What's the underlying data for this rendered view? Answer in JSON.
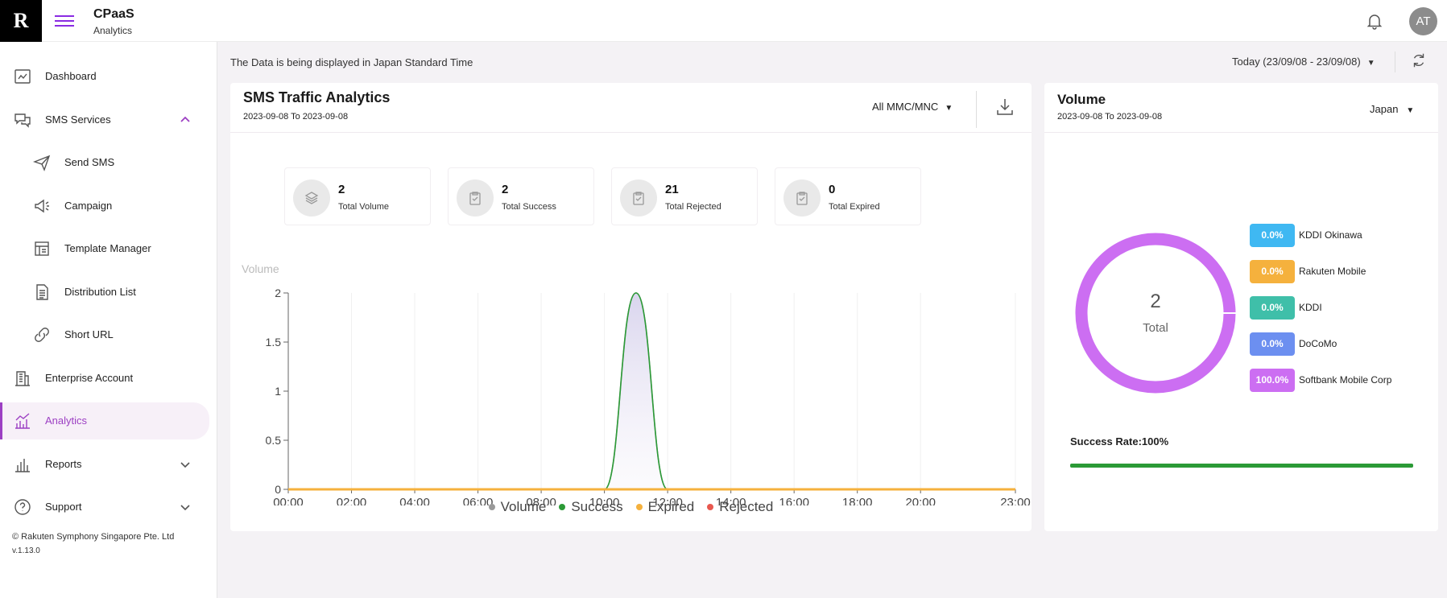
{
  "header": {
    "logo": "R",
    "app_title": "CPaaS",
    "app_subtitle": "Analytics",
    "avatar_initials": "AT"
  },
  "sidebar": {
    "items": [
      {
        "label": "Dashboard",
        "icon": "dashboard-icon"
      },
      {
        "label": "SMS Services",
        "icon": "chat-bubbles-icon",
        "expanded": true
      },
      {
        "label": "Send SMS",
        "icon": "paper-plane-icon"
      },
      {
        "label": "Campaign",
        "icon": "megaphone-icon"
      },
      {
        "label": "Template Manager",
        "icon": "template-icon"
      },
      {
        "label": "Distribution List",
        "icon": "document-list-icon"
      },
      {
        "label": "Short URL",
        "icon": "link-icon"
      },
      {
        "label": "Enterprise Account",
        "icon": "building-icon"
      },
      {
        "label": "Analytics",
        "icon": "analytics-icon",
        "active": true
      },
      {
        "label": "Reports",
        "icon": "bar-chart-icon",
        "expanded": false
      },
      {
        "label": "Support",
        "icon": "help-icon",
        "expanded": false
      }
    ],
    "copyright": "© Rakuten Symphony Singapore Pte. Ltd",
    "version": "v.1.13.0"
  },
  "toolbar": {
    "timezone_note": "The Data is being displayed in Japan Standard Time",
    "date_range": "Today (23/09/08 - 23/09/08)"
  },
  "traffic": {
    "title": "SMS Traffic Analytics",
    "range": "2023-09-08 To 2023-09-08",
    "filter": "All MMC/MNC",
    "stats": [
      {
        "value": "2",
        "label": "Total Volume",
        "icon": "layers-icon"
      },
      {
        "value": "2",
        "label": "Total Success",
        "icon": "clipboard-check-icon"
      },
      {
        "value": "21",
        "label": "Total Rejected",
        "icon": "clipboard-check-icon"
      },
      {
        "value": "0",
        "label": "Total Expired",
        "icon": "clipboard-check-icon"
      }
    ]
  },
  "volume": {
    "title": "Volume",
    "range": "2023-09-08 To 2023-09-08",
    "country": "Japan",
    "donut_total": "2",
    "donut_total_label": "Total",
    "operators": [
      {
        "pct": "0.0%",
        "name": "KDDI Okinawa",
        "color": "#3fb8f2"
      },
      {
        "pct": "0.0%",
        "name": "Rakuten Mobile",
        "color": "#f5b13d"
      },
      {
        "pct": "0.0%",
        "name": "KDDI",
        "color": "#3fbfa9"
      },
      {
        "pct": "0.0%",
        "name": "DoCoMo",
        "color": "#6c8ff0"
      },
      {
        "pct": "100.0%",
        "name": "Softbank Mobile Corp",
        "color": "#cc6ef2"
      }
    ],
    "success_rate_label": "Success Rate",
    "success_rate_value": "100%",
    "success_rate": 1.0
  },
  "chart_data": {
    "type": "line",
    "ylabel": "Volume",
    "x": [
      "00:00",
      "02:00",
      "04:00",
      "06:00",
      "08:00",
      "10:00",
      "11:00",
      "12:00",
      "14:00",
      "16:00",
      "18:00",
      "20:00",
      "23:00"
    ],
    "x_ticks": [
      "00:00",
      "02:00",
      "04:00",
      "06:00",
      "08:00",
      "10:00",
      "12:00",
      "14:00",
      "16:00",
      "18:00",
      "20:00",
      "23:00"
    ],
    "y_ticks": [
      "0",
      "0.5",
      "1",
      "1.5",
      "2"
    ],
    "ylim": [
      0,
      2
    ],
    "xlim": [
      0,
      23
    ],
    "legend_position": "bottom",
    "series": [
      {
        "name": "Volume",
        "color": "#9a9a9a",
        "values": [
          0,
          0,
          0,
          0,
          0,
          0,
          2,
          0,
          0,
          0,
          0,
          0,
          0
        ]
      },
      {
        "name": "Success",
        "color": "#2b9a36",
        "values": [
          0,
          0,
          0,
          0,
          0,
          0,
          2,
          0,
          0,
          0,
          0,
          0,
          0
        ]
      },
      {
        "name": "Expired",
        "color": "#f5b13d",
        "values": [
          0,
          0,
          0,
          0,
          0,
          0,
          0,
          0,
          0,
          0,
          0,
          0,
          0
        ]
      },
      {
        "name": "Rejected",
        "color": "#e8584f",
        "values": [
          0,
          0,
          0,
          0,
          0,
          0,
          0,
          0,
          0,
          0,
          0,
          0,
          0
        ]
      }
    ]
  }
}
